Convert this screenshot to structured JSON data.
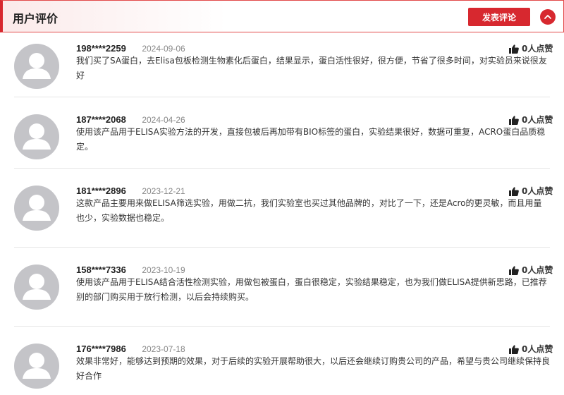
{
  "header": {
    "title": "用户评价",
    "post_button_label": "发表评论",
    "accent_color": "#d7282f"
  },
  "reviews": [
    {
      "user": "198****2259",
      "date": "2024-09-06",
      "likes": "0人点赞",
      "content": "我们买了SA蛋白，去Elisa包板检测生物素化后蛋白，结果显示，蛋白活性很好，很方便，节省了很多时间，对实验员来说很友好"
    },
    {
      "user": "187****2068",
      "date": "2024-04-26",
      "likes": "0人点赞",
      "content": "使用该产品用于ELISA实验方法的开发，直接包被后再加带有BIO标签的蛋白，实验结果很好，数据可重复，ACRO蛋白品质稳定。"
    },
    {
      "user": "181****2896",
      "date": "2023-12-21",
      "likes": "0人点赞",
      "content": "这款产品主要用来做ELISA筛选实验，用做二抗，我们实验室也买过其他品牌的，对比了一下，还是Acro的更灵敏，而且用量也少，实验数据也稳定。"
    },
    {
      "user": "158****7336",
      "date": "2023-10-19",
      "likes": "0人点赞",
      "content": "使用该产品用于ELISA结合活性检测实验，用做包被蛋白，蛋白很稳定，实验结果稳定，也为我们做ELISA提供新思路，已推荐别的部门购买用于放行检测，以后会持续购买。"
    },
    {
      "user": "176****7986",
      "date": "2023-07-18",
      "likes": "0人点赞",
      "content": "效果非常好，能够达到预期的效果，对于后续的实验开展帮助很大，以后还会继续订购贵公司的产品，希望与贵公司继续保持良好合作"
    }
  ]
}
